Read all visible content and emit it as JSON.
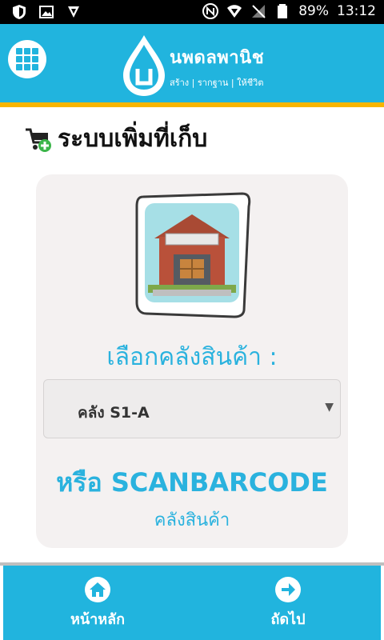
{
  "status": {
    "battery": "89%",
    "time": "13:12"
  },
  "header": {
    "brand": "นพดลพานิช",
    "tagline": "สร้าง | รากฐาน | ให้ชีวิต"
  },
  "page": {
    "title": "ระบบเพิ่มที่เก็บ"
  },
  "form": {
    "select_label": "เลือกคลังสินค้า :",
    "selected_warehouse": "คลัง S1-A",
    "or_word": "หรือ",
    "scan_text": "SCANBARCODE",
    "scan_sub": "คลังสินค้า"
  },
  "nav": {
    "home": "หน้าหลัก",
    "next": "ถัดไป"
  },
  "colors": {
    "primary": "#21b4de",
    "accent": "#f7b500"
  }
}
